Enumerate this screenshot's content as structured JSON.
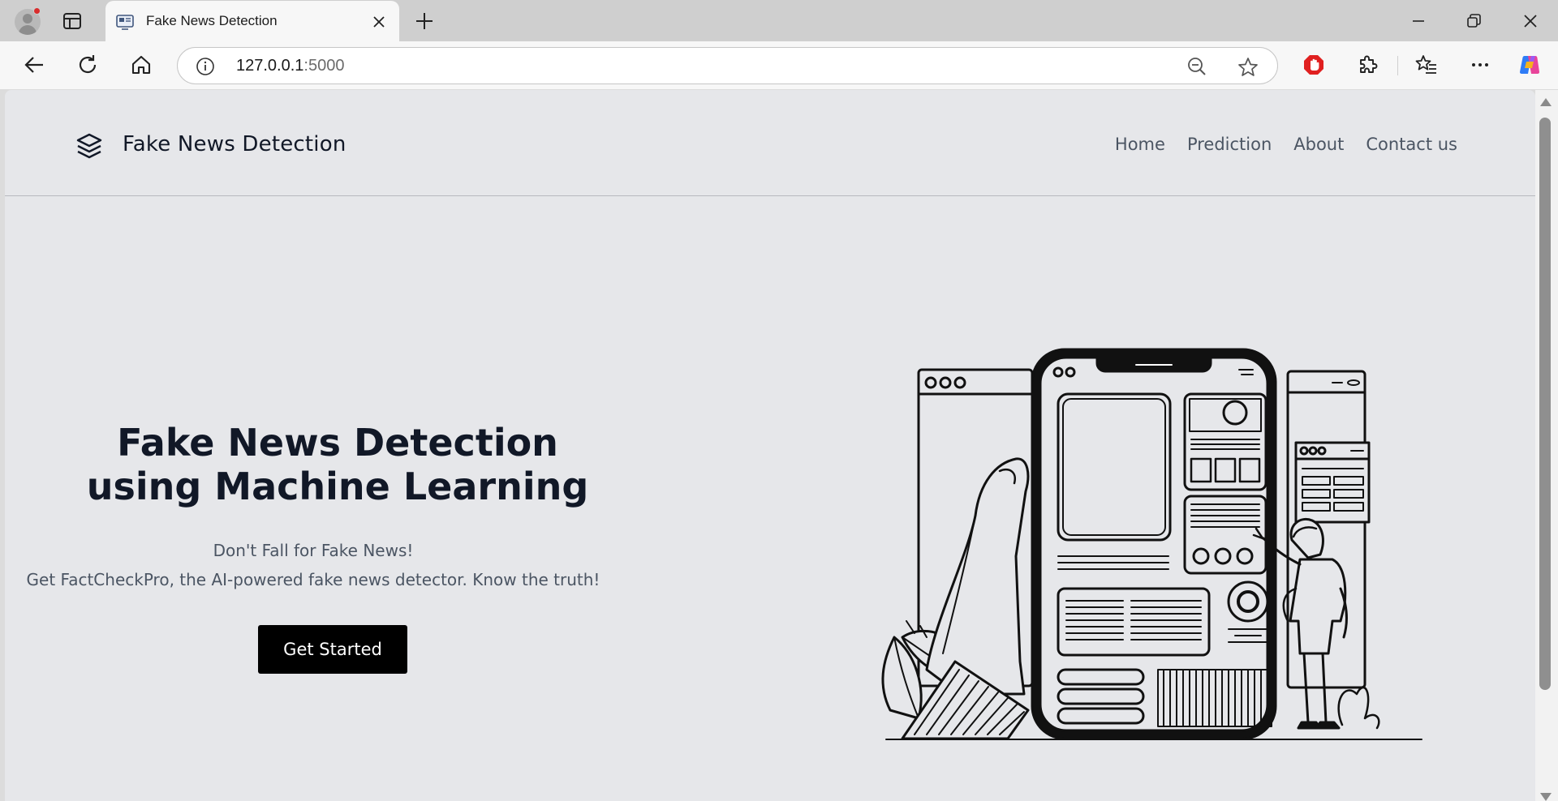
{
  "browser": {
    "tab": {
      "title": "Fake News Detection"
    },
    "address": {
      "host": "127.0.0.1",
      "port": ":5000"
    }
  },
  "site": {
    "brand": "Fake News Detection",
    "nav": [
      {
        "label": "Home"
      },
      {
        "label": "Prediction"
      },
      {
        "label": "About"
      },
      {
        "label": "Contact us"
      }
    ],
    "hero": {
      "title_line1": "Fake News Detection",
      "title_line2": "using Machine Learning",
      "subtitle_line1": "Don't Fall for Fake News!",
      "subtitle_line2": "Get FactCheckPro, the AI-powered fake news detector. Know the truth!",
      "cta_label": "Get Started"
    }
  },
  "colors": {
    "page_bg": "#e6e7ea",
    "heading": "#111827",
    "body_text": "#4b5563",
    "button_bg": "#000000",
    "button_text": "#ffffff"
  },
  "icons": {
    "browser": [
      "profile-icon",
      "tab-actions-icon",
      "tab-favicon-icon",
      "tab-close-icon",
      "new-tab-icon",
      "minimize-icon",
      "restore-icon",
      "window-close-icon",
      "back-icon",
      "refresh-icon",
      "home-icon",
      "site-info-icon",
      "zoom-out-icon",
      "favorite-star-icon",
      "adblock-icon",
      "extensions-icon",
      "favorites-icon",
      "more-icon",
      "copilot-icon"
    ],
    "site": [
      "layers-icon"
    ]
  }
}
